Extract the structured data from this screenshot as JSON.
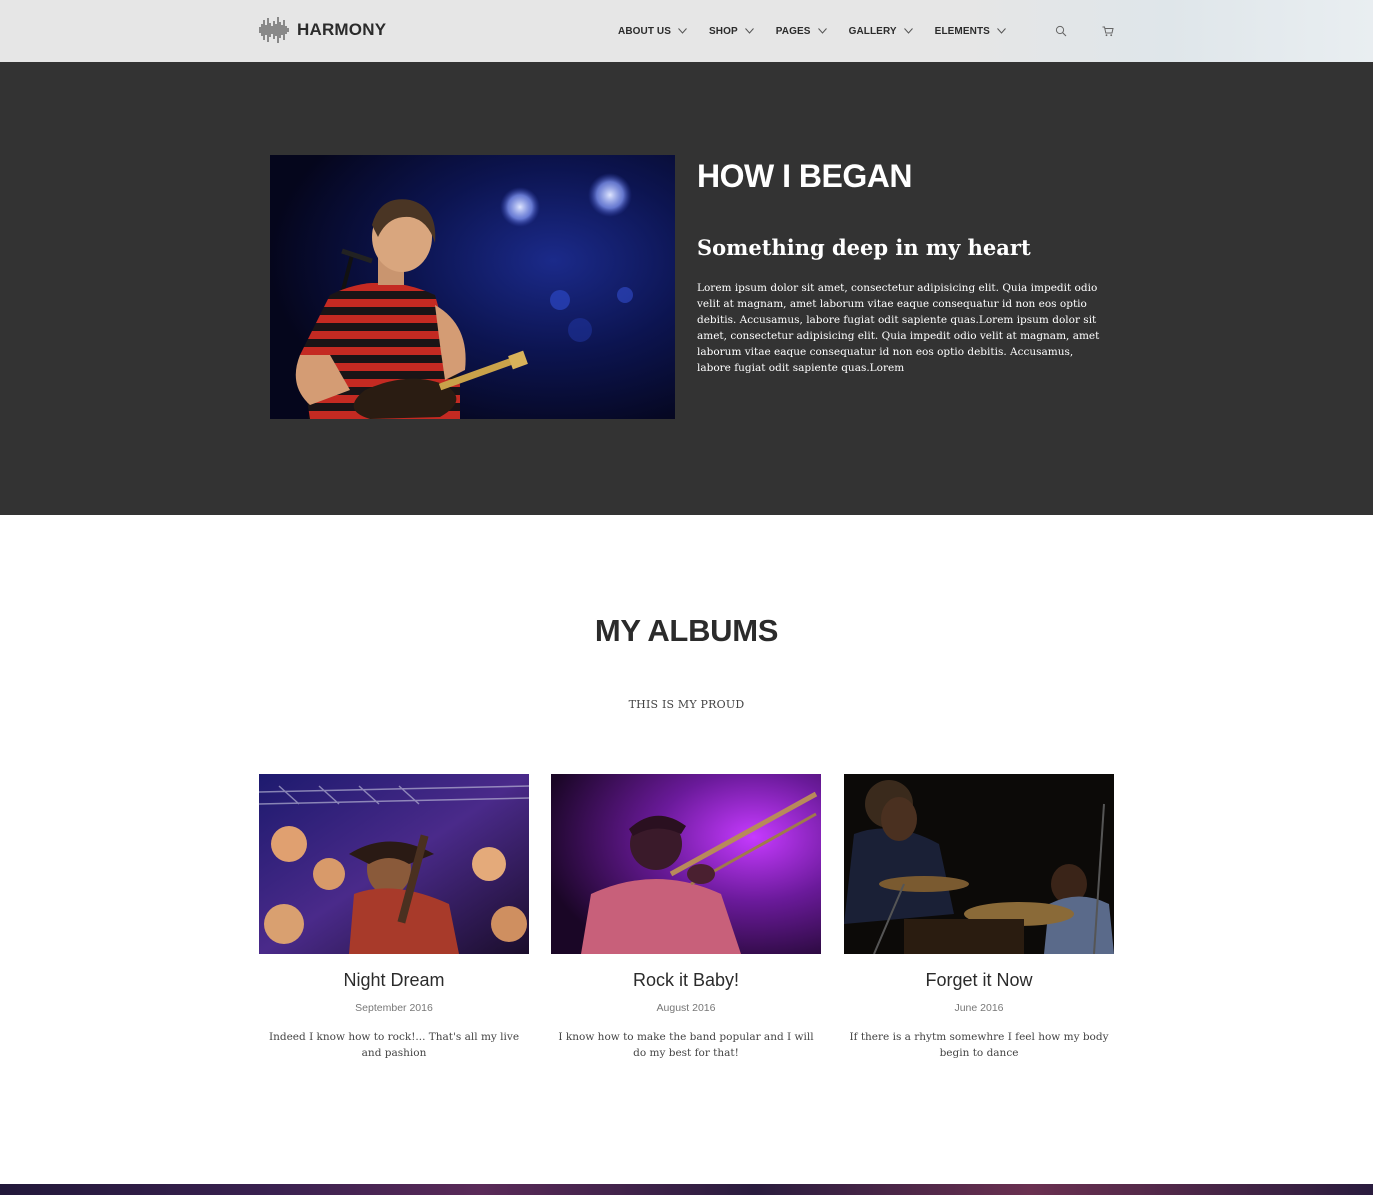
{
  "header": {
    "logo_text": "HARMONY",
    "nav": [
      {
        "label": "ABOUT US"
      },
      {
        "label": "SHOP"
      },
      {
        "label": "PAGES"
      },
      {
        "label": "GALLERY"
      },
      {
        "label": "ELEMENTS"
      }
    ],
    "icons": [
      "search-icon",
      "cart-icon"
    ]
  },
  "about": {
    "title": "HOW I BEGAN",
    "subtitle": "Something deep in my heart",
    "body": "Lorem ipsum dolor sit amet, consectetur adipisicing elit. Quia impedit odio velit at magnam, amet laborum vitae eaque consequatur id non eos optio debitis. Accusamus, labore fugiat odit sapiente quas.Lorem ipsum dolor sit amet, consectetur adipisicing elit. Quia impedit odio velit at magnam, amet laborum vitae eaque consequatur id non eos optio debitis. Accusamus, labore fugiat odit sapiente quas.Lorem"
  },
  "albums": {
    "title": "MY ALBUMS",
    "subtitle": "THIS IS MY PROUD",
    "items": [
      {
        "title": "Night Dream",
        "date": "September 2016",
        "text": "Indeed I know how to rock!... That's all my live and pashion"
      },
      {
        "title": "Rock it Baby!",
        "date": "August 2016",
        "text": "I know how to make the band popular and I will do my best for that!"
      },
      {
        "title": "Forget it Now",
        "date": "June 2016",
        "text": "If there is a rhytm somewhre I feel how my body begin to dance"
      }
    ]
  },
  "colors": {
    "header_bg": "#e6e6e6",
    "dark_section_bg": "#333333",
    "text_dark": "#2b2b2b"
  }
}
